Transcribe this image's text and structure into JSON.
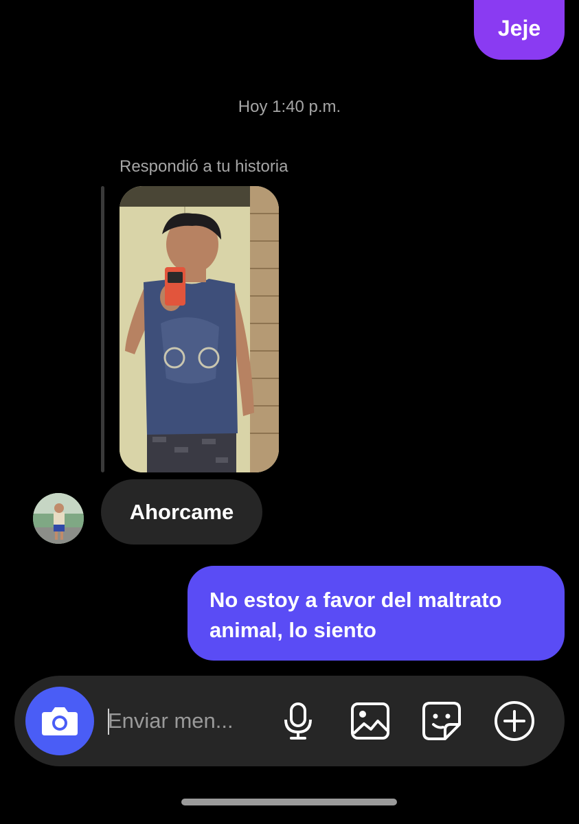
{
  "messages": {
    "top_outgoing": "Jeje",
    "timestamp": "Hoy 1:40 p.m.",
    "story_reply_label": "Respondió a tu historia",
    "incoming": "Ahorcame",
    "outgoing": "No estoy a favor del maltrato animal, lo siento"
  },
  "composer": {
    "placeholder": "Enviar men..."
  },
  "icons": {
    "camera": "camera-icon",
    "mic": "microphone-icon",
    "gallery": "gallery-icon",
    "sticker": "sticker-icon",
    "more": "plus-circle-icon"
  },
  "colors": {
    "outgoing_top": "#8a3bf2",
    "outgoing": "#5a4cf5",
    "incoming": "#262626",
    "camera_button": "#4a5df6"
  }
}
